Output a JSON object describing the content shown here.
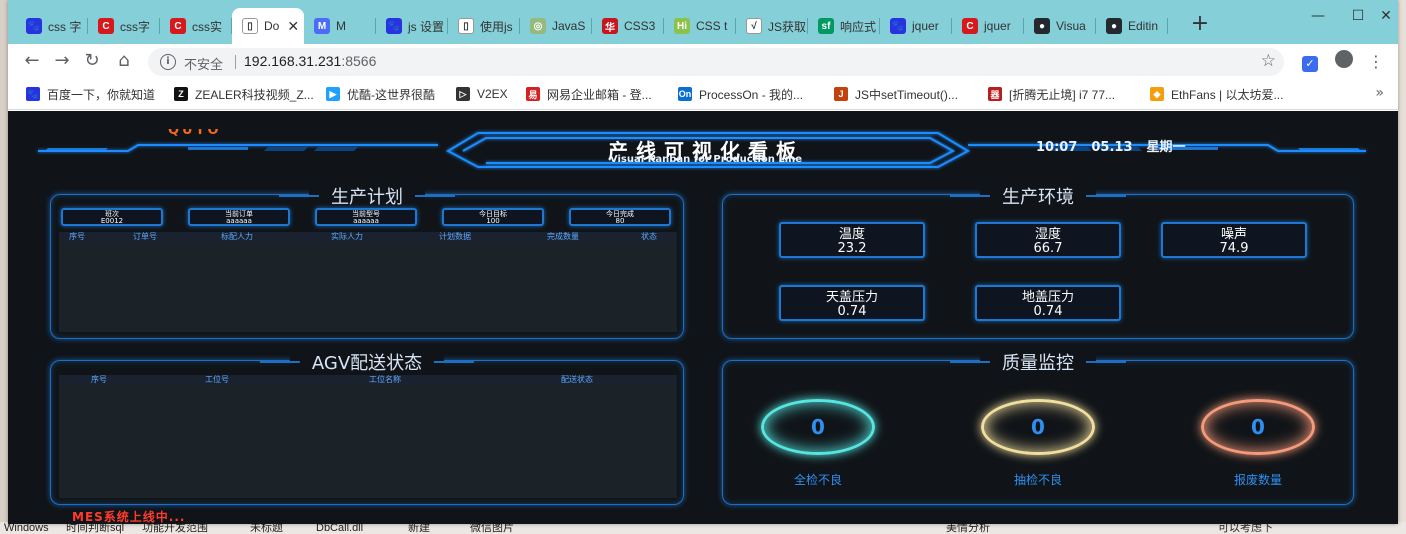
{
  "browser": {
    "tabs": [
      {
        "label": "css 字",
        "icon": "baidu-paw-icon",
        "color": "#2932e1",
        "glyph": "🐾"
      },
      {
        "label": "css字",
        "icon": "csdn-icon",
        "color": "#d7191c",
        "glyph": "C"
      },
      {
        "label": "css实",
        "icon": "csdn-icon",
        "color": "#d7191c",
        "glyph": "C"
      },
      {
        "label": "Do",
        "icon": "document-icon",
        "color": "#ffffff",
        "glyph": "▯"
      },
      {
        "label": "M",
        "icon": "mubu-icon",
        "color": "#4a6cf7",
        "glyph": "M"
      },
      {
        "label": "js 设置",
        "icon": "baidu-paw-icon",
        "color": "#2932e1",
        "glyph": "🐾"
      },
      {
        "label": "使用js",
        "icon": "document-icon",
        "color": "#ffffff",
        "glyph": "▯"
      },
      {
        "label": "JavaS",
        "icon": "runoob-icon",
        "color": "#96b97d",
        "glyph": "◎"
      },
      {
        "label": "CSS3",
        "icon": "w3cschool-icon",
        "color": "#c8161e",
        "glyph": "华"
      },
      {
        "label": "CSS t",
        "icon": "hi-icon",
        "color": "#8bc34a",
        "glyph": "Hi"
      },
      {
        "label": "JS获取",
        "icon": "hp-icon",
        "color": "#ffffff",
        "glyph": "√"
      },
      {
        "label": "响应式",
        "icon": "segmentfault-icon",
        "color": "#009a61",
        "glyph": "sf"
      },
      {
        "label": "jquer",
        "icon": "baidu-paw-icon",
        "color": "#2932e1",
        "glyph": "🐾"
      },
      {
        "label": "jquer",
        "icon": "csdn-icon",
        "color": "#d7191c",
        "glyph": "C"
      },
      {
        "label": "Visua",
        "icon": "github-icon",
        "color": "#24292e",
        "glyph": "●"
      },
      {
        "label": "Editin",
        "icon": "github-icon",
        "color": "#24292e",
        "glyph": "●"
      }
    ],
    "security_label": "不安全",
    "url_host": "192.168.31.231",
    "url_port": ":8566",
    "bookmarks": [
      {
        "label": "百度一下，你就知道",
        "icon": "baidu-paw-icon",
        "color": "#2932e1",
        "glyph": "🐾"
      },
      {
        "label": "ZEALER科技视频_Z...",
        "icon": "zealer-icon",
        "color": "#111111",
        "glyph": "Z"
      },
      {
        "label": "优酷-这世界很酷",
        "icon": "youku-icon",
        "color": "#1ea0ff",
        "glyph": "▶"
      },
      {
        "label": "V2EX",
        "icon": "v2ex-icon",
        "color": "#333333",
        "glyph": "▷"
      },
      {
        "label": "网易企业邮箱 - 登...",
        "icon": "netease-icon",
        "color": "#d52121",
        "glyph": "易"
      },
      {
        "label": "ProcessOn - 我的...",
        "icon": "processon-icon",
        "color": "#0b6fd1",
        "glyph": "On"
      },
      {
        "label": "JS中setTimeout()...",
        "icon": "js-icon",
        "color": "#c2410c",
        "glyph": "J"
      },
      {
        "label": "[折腾无止境] i7 77...",
        "icon": "chiphell-icon",
        "color": "#b91c1c",
        "glyph": "器"
      },
      {
        "label": "EthFans | 以太坊爱...",
        "icon": "ethereum-icon",
        "color": "#f59e0b",
        "glyph": "◆"
      }
    ]
  },
  "dashboard": {
    "title": "产线可视化看板",
    "subtitle": "Visual Kanban for Production Line",
    "time": "10:07",
    "date": "05.13",
    "weekday": "星期一",
    "ticker": "MES系统上线中...",
    "plan": {
      "title": "生产计划",
      "boxes": [
        {
          "label": "班次",
          "value": "E0012"
        },
        {
          "label": "当前订单",
          "value": "aaaaaa"
        },
        {
          "label": "当前型号",
          "value": "aaaaaa"
        },
        {
          "label": "今日目标",
          "value": "100"
        },
        {
          "label": "今日完成",
          "value": "80"
        }
      ],
      "columns": [
        "序号",
        "订单号",
        "标配人力",
        "实际人力",
        "计划数据",
        "完成数量",
        "状态"
      ]
    },
    "env": {
      "title": "生产环境",
      "items": [
        {
          "label": "温度",
          "value": "23.2"
        },
        {
          "label": "湿度",
          "value": "66.7"
        },
        {
          "label": "噪声",
          "value": "74.9"
        },
        {
          "label": "天盖压力",
          "value": "0.74"
        },
        {
          "label": "地盖压力",
          "value": "0.74"
        }
      ]
    },
    "agv": {
      "title": "AGV配送状态",
      "columns": [
        "序号",
        "工位号",
        "工位名称",
        "配送状态"
      ]
    },
    "quality": {
      "title": "质量监控",
      "rings": [
        {
          "label": "全检不良",
          "value": "0",
          "color": "#57e5e0"
        },
        {
          "label": "抽检不良",
          "value": "0",
          "color": "#f2dfa0"
        },
        {
          "label": "报废数量",
          "value": "0",
          "color": "#f59a7a"
        }
      ]
    }
  },
  "taskbar": [
    "Windows",
    "时间判断sql",
    "功能开发范围",
    "未标题",
    "DbCall.dll",
    "新建",
    "微信图片",
    "美情分析",
    "可以考虑下"
  ]
}
